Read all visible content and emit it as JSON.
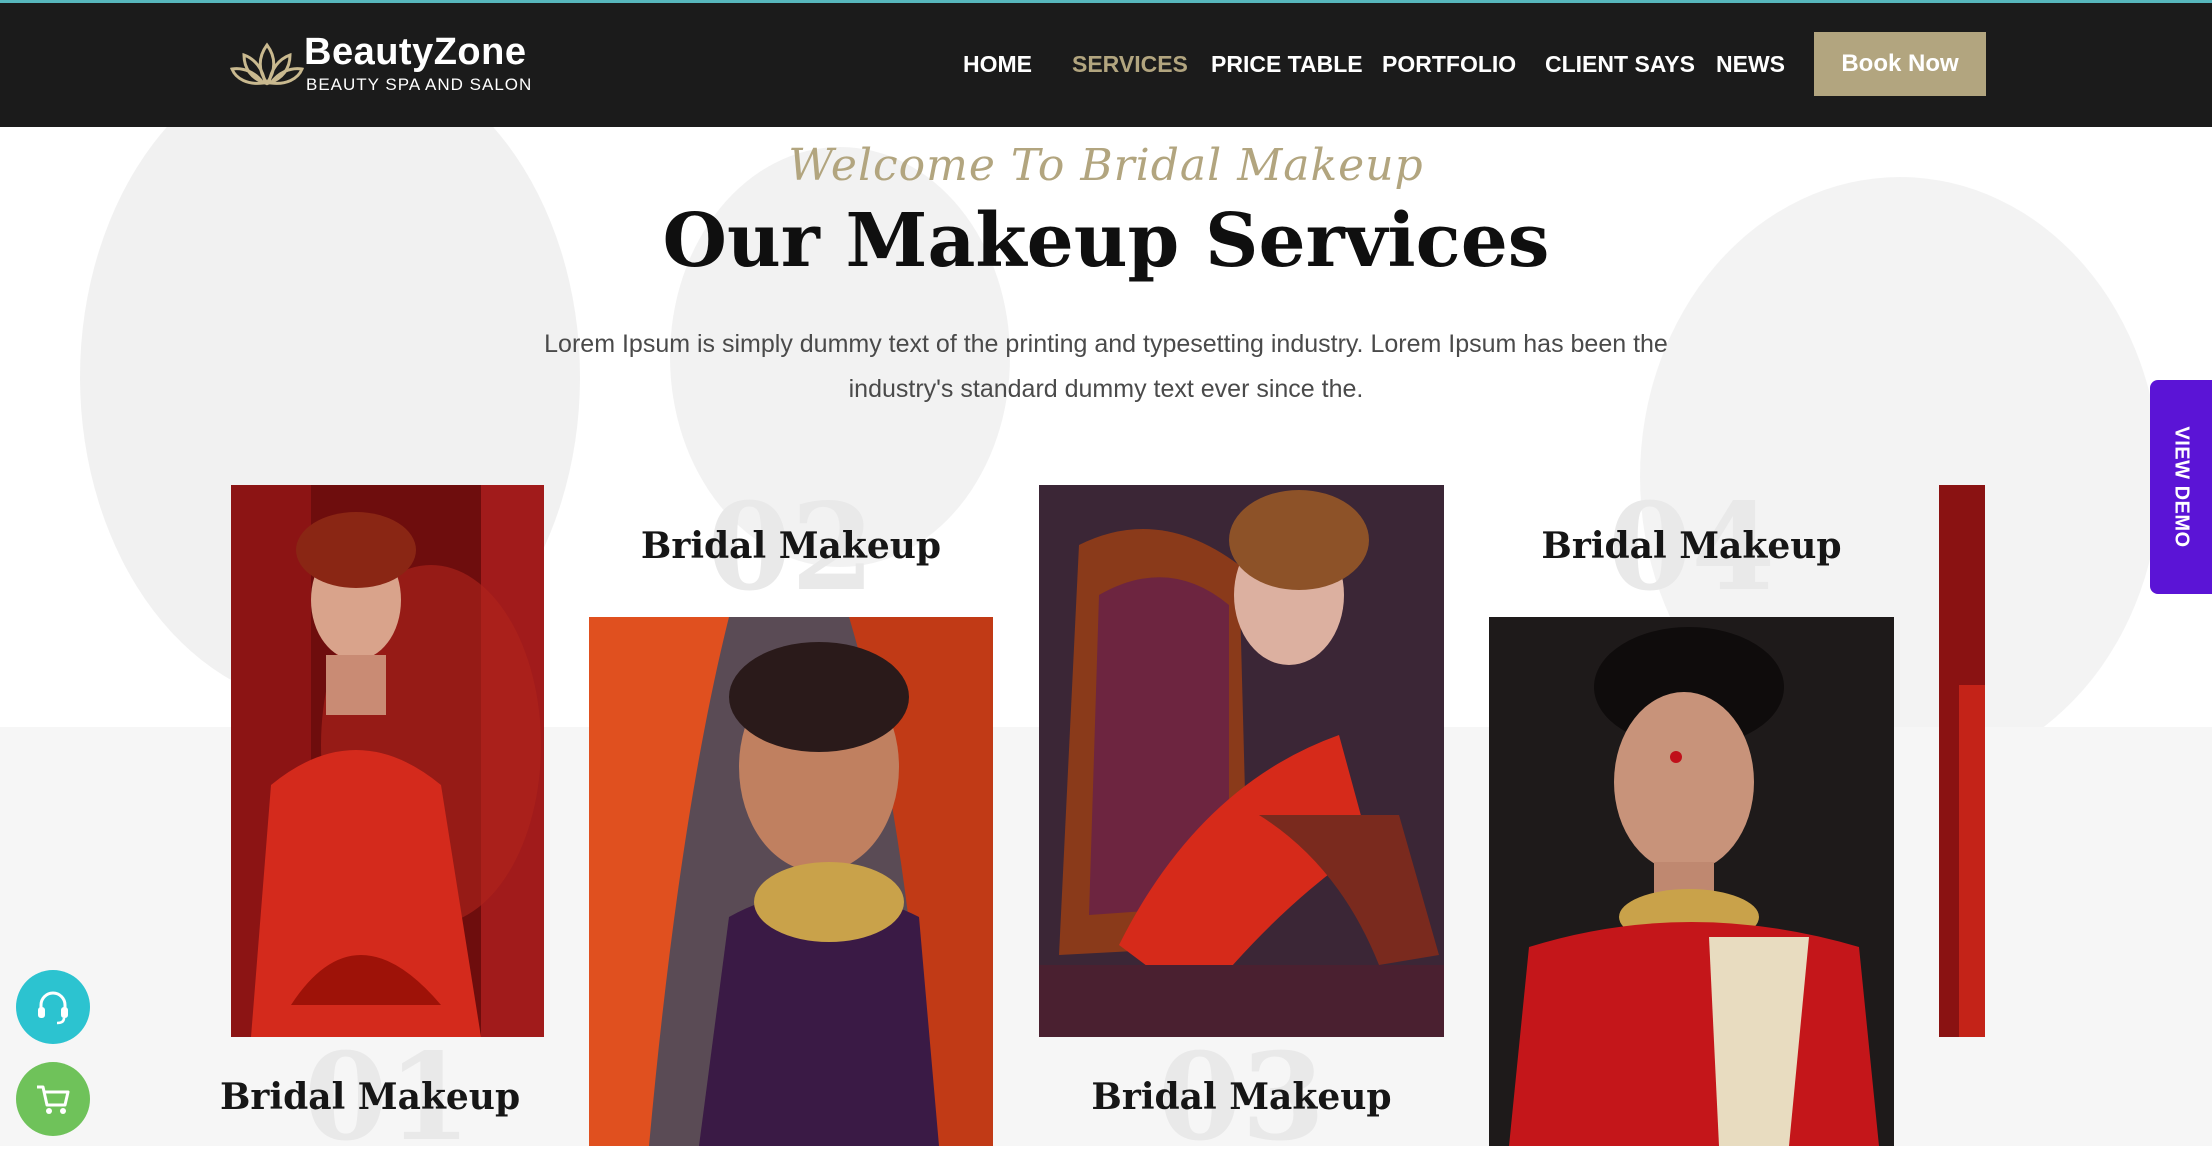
{
  "brand": {
    "name": "BeautyZone",
    "tagline": "BEAUTY SPA AND SALON",
    "logo_icon": "lotus-icon"
  },
  "nav": {
    "items": [
      {
        "label": "HOME",
        "active": false
      },
      {
        "label": "SERVICES",
        "active": true
      },
      {
        "label": "PRICE TABLE",
        "active": false
      },
      {
        "label": "PORTFOLIO",
        "active": false
      },
      {
        "label": "CLIENT SAYS",
        "active": false
      },
      {
        "label": "NEWS",
        "active": false
      }
    ],
    "cta": "Book Now"
  },
  "section": {
    "script_title": "Welcome To Bridal Makeup",
    "title": "Our Makeup Services",
    "intro": "Lorem Ipsum is simply dummy text of the printing and typesetting industry. Lorem Ipsum has been the industry's standard dummy text ever since the."
  },
  "cards": [
    {
      "number": "01",
      "title": "Bridal Makeup"
    },
    {
      "number": "02",
      "title": "Bridal Makeup"
    },
    {
      "number": "03",
      "title": "Bridal Makeup"
    },
    {
      "number": "04",
      "title": "Bridal Makeup"
    }
  ],
  "side_tab": "VIEW DEMO",
  "floating_buttons": {
    "support_icon": "headset-icon",
    "cart_icon": "cart-icon"
  },
  "colors": {
    "header_bg": "#1b1b1b",
    "accent_gold": "#b2a57f",
    "demo_purple": "#5b14d6",
    "support_teal": "#2cc3d0",
    "cart_green": "#6fc25a"
  }
}
